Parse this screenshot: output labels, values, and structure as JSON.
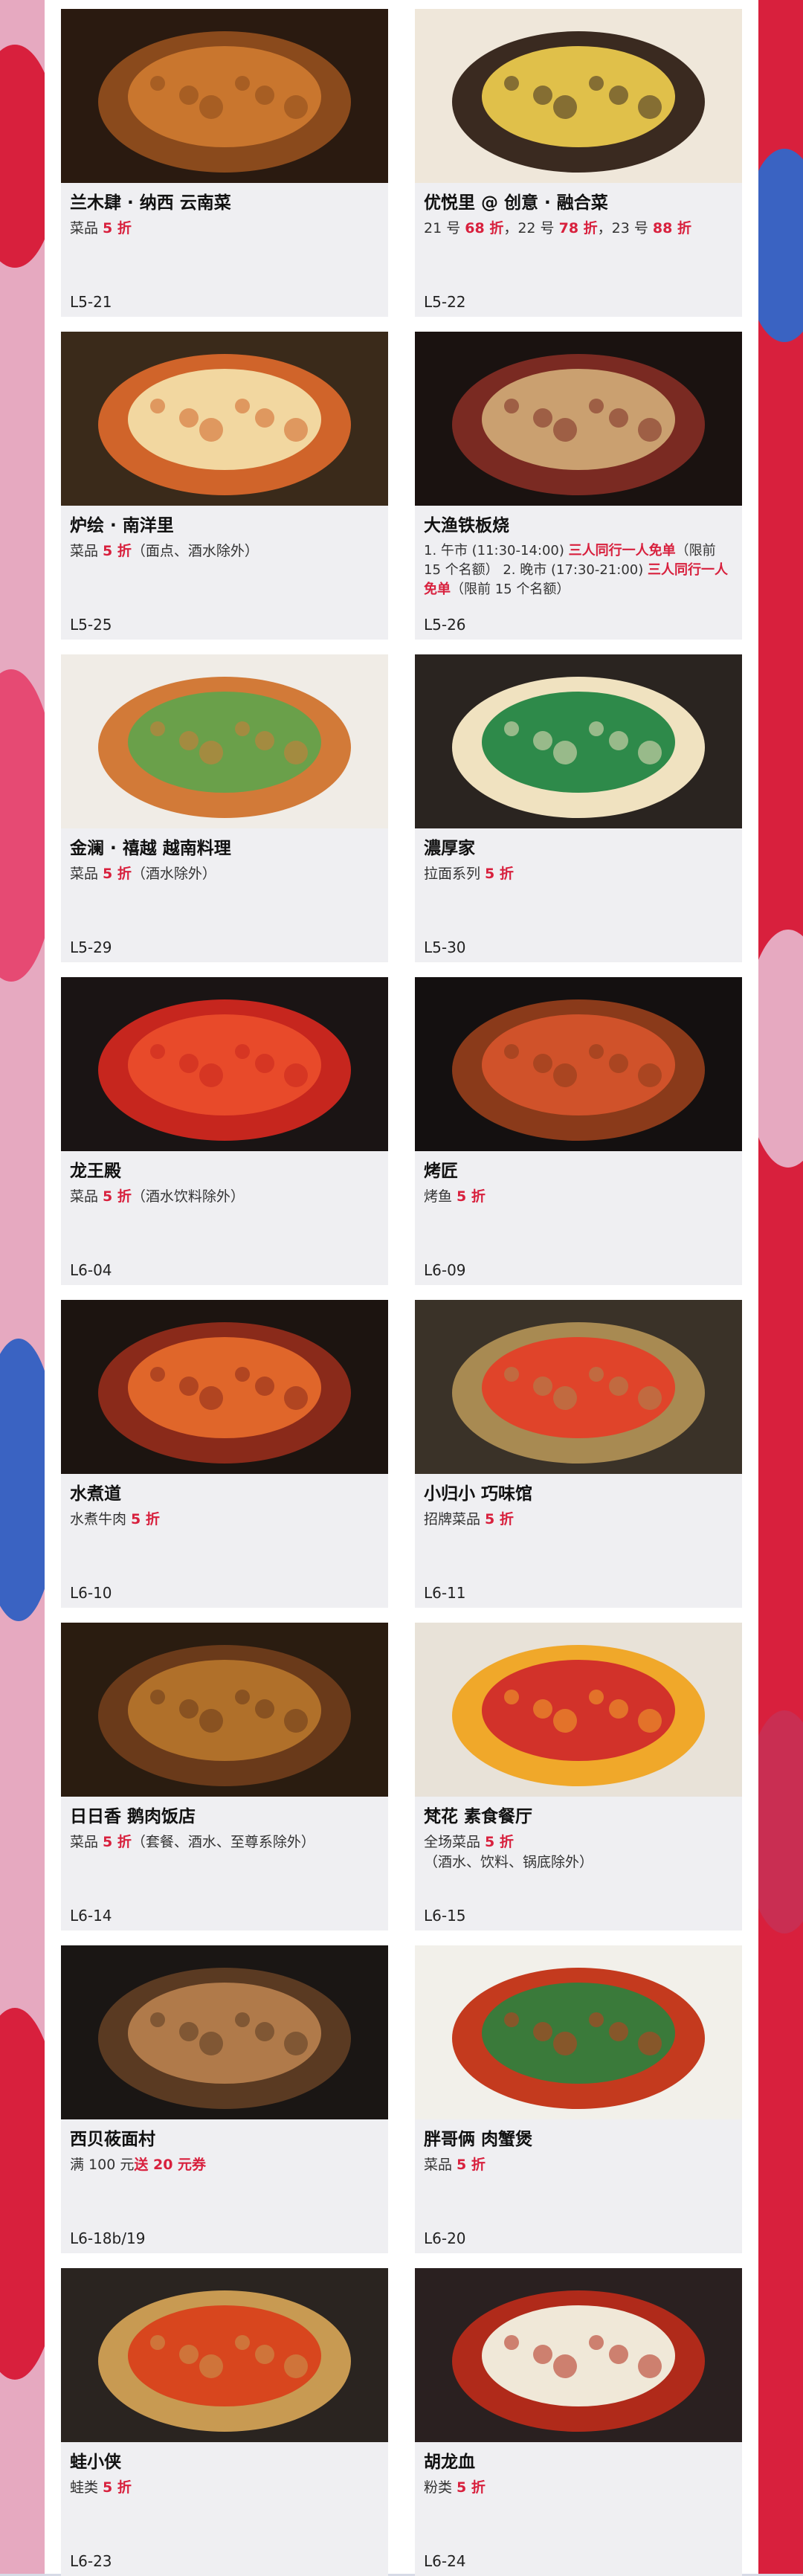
{
  "theme": {
    "accent": "#d8203d",
    "card_bg": "#efeff2"
  },
  "restaurants": [
    {
      "name": "兰木肆 · 纳西 云南菜",
      "desc": [
        {
          "t": "菜品 "
        },
        {
          "t": "5 折",
          "red": true
        }
      ],
      "code": "L5-21",
      "photo": "fried-insects-photo"
    },
    {
      "name": "优悦里 @ 创意 · 融合菜",
      "desc": [
        {
          "t": "21 号 "
        },
        {
          "t": "68 折",
          "red": true
        },
        {
          "t": "，22 号 "
        },
        {
          "t": "78 折",
          "red": true
        },
        {
          "t": "，23 号 "
        },
        {
          "t": "88 折",
          "red": true
        }
      ],
      "code": "L5-22",
      "photo": "soup-pot-photo"
    },
    {
      "name": "炉绘 · 南洋里",
      "desc": [
        {
          "t": "菜品 "
        },
        {
          "t": "5 折",
          "red": true
        },
        {
          "t": "（面点、酒水除外）"
        }
      ],
      "code": "L5-25",
      "photo": "crab-feast-photo"
    },
    {
      "name": "大渔铁板烧",
      "desc": [
        {
          "t": "1. 午市 (11:30-14:00) "
        },
        {
          "t": "三人同行一人免单",
          "red": true
        },
        {
          "t": "（限前 15 个名额） 2. 晚市 (17:30-21:00) "
        },
        {
          "t": "三人同行一人免单",
          "red": true
        },
        {
          "t": "（限前 15 个名额）"
        }
      ],
      "small": true,
      "code": "L5-26",
      "photo": "steak-teppanyaki-photo"
    },
    {
      "name": "金澜 · 禧越 越南料理",
      "desc": [
        {
          "t": "菜品 "
        },
        {
          "t": "5 折",
          "red": true
        },
        {
          "t": "（酒水除外）"
        }
      ],
      "code": "L5-29",
      "photo": "vietnamese-spread-photo"
    },
    {
      "name": "濃厚家",
      "desc": [
        {
          "t": "拉面系列 "
        },
        {
          "t": "5 折",
          "red": true
        }
      ],
      "code": "L5-30",
      "photo": "ramen-photo"
    },
    {
      "name": "龙王殿",
      "desc": [
        {
          "t": "菜品 "
        },
        {
          "t": "5 折",
          "red": true
        },
        {
          "t": "（酒水饮料除外）"
        }
      ],
      "code": "L6-04",
      "photo": "crayfish-photo"
    },
    {
      "name": "烤匠",
      "desc": [
        {
          "t": "烤鱼 "
        },
        {
          "t": "5 折",
          "red": true
        }
      ],
      "code": "L6-09",
      "photo": "grilled-fish-photo"
    },
    {
      "name": "水煮道",
      "desc": [
        {
          "t": "水煮牛肉 "
        },
        {
          "t": "5 折",
          "red": true
        }
      ],
      "code": "L6-10",
      "photo": "boiled-beef-photo"
    },
    {
      "name": "小归小 巧味馆",
      "desc": [
        {
          "t": "招牌菜品 "
        },
        {
          "t": "5 折",
          "red": true
        }
      ],
      "code": "L6-11",
      "photo": "peas-dish-photo"
    },
    {
      "name": "日日香 鹅肉饭店",
      "desc": [
        {
          "t": "菜品 "
        },
        {
          "t": "5 折",
          "red": true
        },
        {
          "t": "（套餐、酒水、至尊系除外）"
        }
      ],
      "code": "L6-14",
      "photo": "roast-goose-photo"
    },
    {
      "name": "梵花 素食餐厅",
      "desc": [
        {
          "t": "全场菜品 "
        },
        {
          "t": "5 折",
          "red": true
        },
        {
          "t": "\n（酒水、饮料、锅底除外）"
        }
      ],
      "code": "L6-15",
      "photo": "veggie-pot-photo"
    },
    {
      "name": "西贝莜面村",
      "desc": [
        {
          "t": "满 100 元"
        },
        {
          "t": "送 20 元券",
          "red": true
        }
      ],
      "code": "L6-18b/19",
      "photo": "lamb-skewers-photo"
    },
    {
      "name": "胖哥俩 肉蟹煲",
      "desc": [
        {
          "t": "菜品 "
        },
        {
          "t": "5 折",
          "red": true
        }
      ],
      "code": "L6-20",
      "photo": "crab-pot-photo"
    },
    {
      "name": "蛙小侠",
      "desc": [
        {
          "t": "蛙类 "
        },
        {
          "t": "5 折",
          "red": true
        }
      ],
      "code": "L6-23",
      "photo": "spicy-frog-photo"
    },
    {
      "name": "胡龙血",
      "desc": [
        {
          "t": "粉类 "
        },
        {
          "t": "5 折",
          "red": true
        }
      ],
      "code": "L6-24",
      "photo": "noodle-bowl-photo"
    }
  ]
}
